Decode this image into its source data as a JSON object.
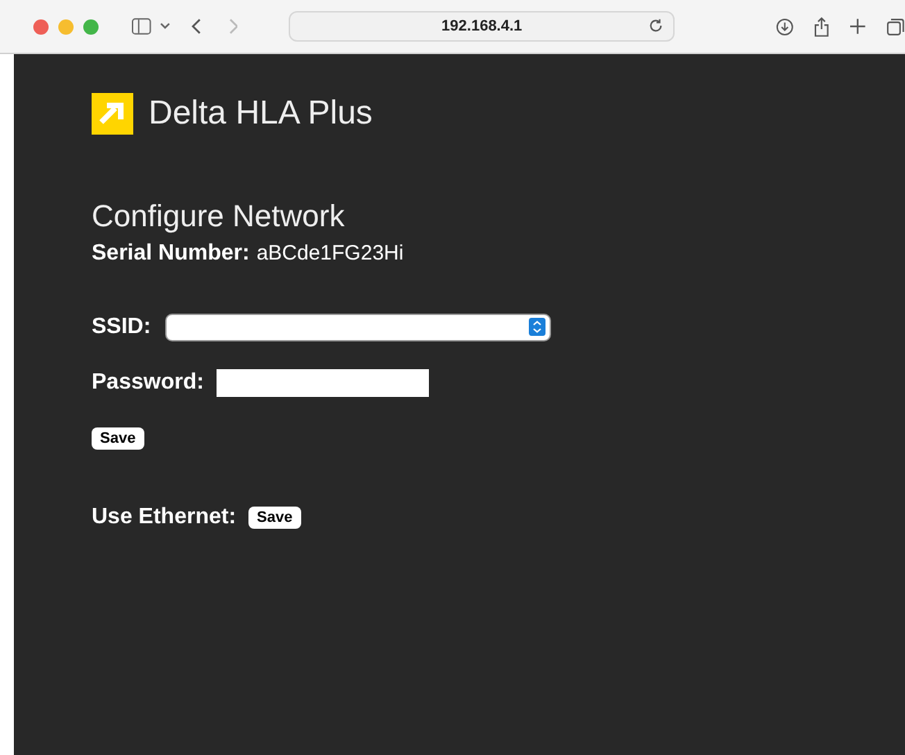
{
  "browser": {
    "url": "192.168.4.1"
  },
  "header": {
    "title": "Delta HLA Plus"
  },
  "page": {
    "heading": "Configure Network",
    "serial_label": "Serial Number:",
    "serial_value": "aBCde1FG23Hi"
  },
  "form": {
    "ssid_label": "SSID:",
    "password_label": "Password:",
    "save_button": "Save"
  },
  "ethernet": {
    "label": "Use Ethernet:",
    "save_button": "Save"
  }
}
